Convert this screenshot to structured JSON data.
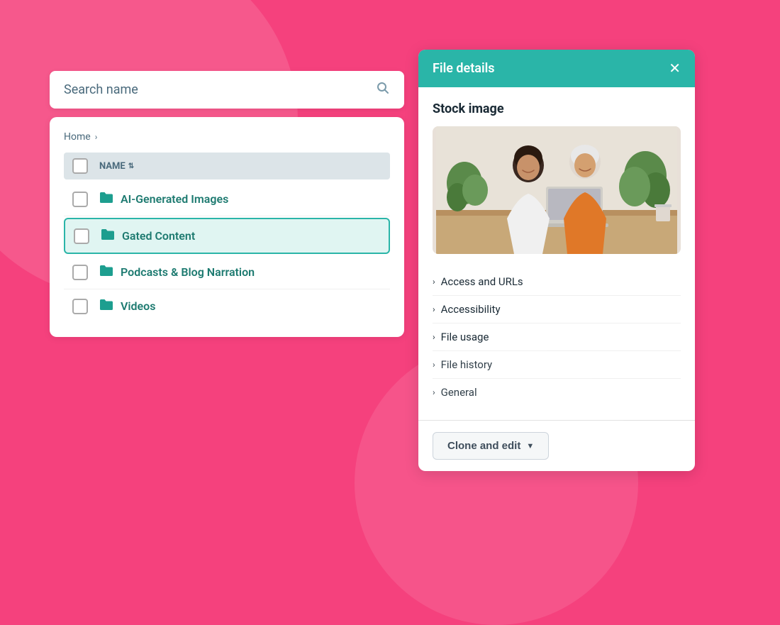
{
  "search": {
    "placeholder": "Search name"
  },
  "breadcrumb": {
    "home": "Home",
    "chevron": "›"
  },
  "table": {
    "column_name": "NAME"
  },
  "folders": [
    {
      "id": "ai-generated",
      "name": "AI-Generated Images",
      "active": false
    },
    {
      "id": "gated-content",
      "name": "Gated Content",
      "active": true
    },
    {
      "id": "podcasts",
      "name": "Podcasts & Blog Narration",
      "active": false
    },
    {
      "id": "videos",
      "name": "Videos",
      "active": false
    }
  ],
  "file_details": {
    "panel_title": "File details",
    "section_title": "Stock image",
    "close_icon": "✕",
    "accordion_items": [
      "Access and URLs",
      "Accessibility",
      "File usage",
      "File history",
      "General"
    ],
    "clone_button": "Clone and edit"
  },
  "icons": {
    "search": "🔍",
    "folder": "📁",
    "chevron_right": "›",
    "chevron_down": "›",
    "sort_up": "⇅",
    "dropdown_arrow": "▼"
  }
}
